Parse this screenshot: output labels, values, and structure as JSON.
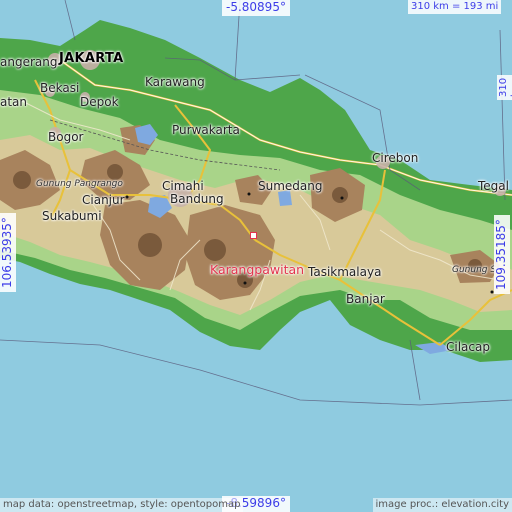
{
  "coords": {
    "top": "-5.80895°",
    "bottom": "-8.59896°",
    "left": "106.53935°",
    "right": "109.35185°"
  },
  "scale": {
    "horizontal": "310 km = 193 mi",
    "vertical": "310 km = 193 mi"
  },
  "credits": {
    "left": "map data: openstreetmap, style: opentopomap",
    "right": "image proc.: elevation.city"
  },
  "places": {
    "jakarta": "JAKARTA",
    "tangerang": "angerang",
    "bekasi": "Bekasi",
    "depok": "Depok",
    "batan": "atan",
    "karawang": "Karawang",
    "bogor": "Bogor",
    "purwakarta": "Purwakarta",
    "cirebon": "Cirebon",
    "gunung_pangrango": "Gunung Pangrango",
    "cianjur": "Cianjur",
    "cimahi": "Cimahi",
    "bandung": "Bandung",
    "sumedang": "Sumedang",
    "tegal": "Tegal",
    "sukabumi": "Sukabumi",
    "karangpawitan": "Karangpawitan",
    "tasikmalaya": "Tasikmalaya",
    "gunung_s": "Gunung S",
    "banjar": "Banjar",
    "cilacap": "Cilacap"
  },
  "colors": {
    "sea": "#8fcbe0",
    "lowland": "#4ea64a",
    "plain": "#a9d489",
    "hills": "#d8c999",
    "mountains": "#a8835d",
    "peaks": "#7a5a3c",
    "target": "#e3344e",
    "coord_text": "#3d3de8"
  }
}
